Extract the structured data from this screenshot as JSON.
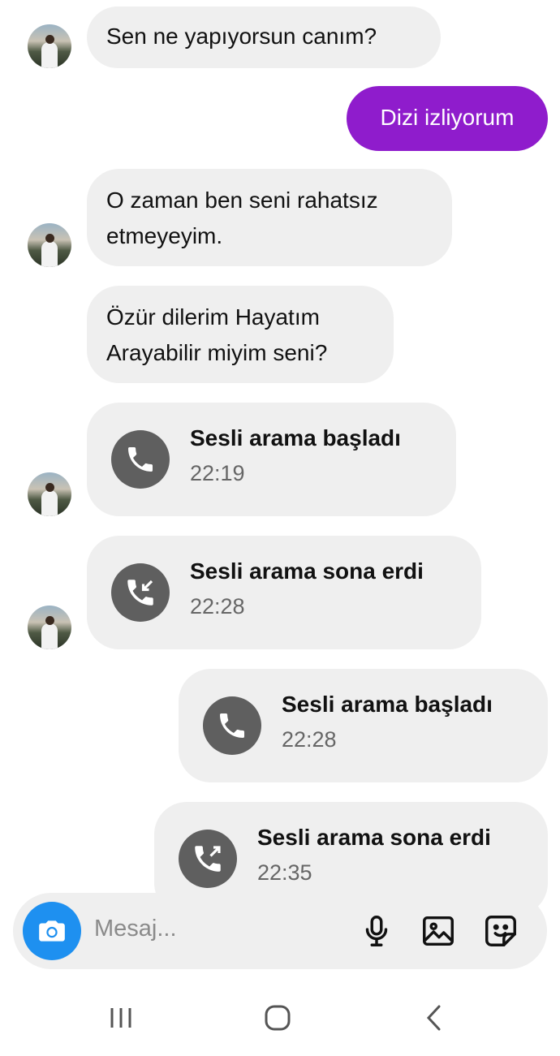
{
  "messages": [
    {
      "kind": "text",
      "side": "received",
      "text": "Sen ne yapıyorsun canım?"
    },
    {
      "kind": "text",
      "side": "sent",
      "text": "Dizi izliyorum"
    },
    {
      "kind": "text",
      "side": "received",
      "text": "O zaman ben seni rahatsız etmeyeyim."
    },
    {
      "kind": "text",
      "side": "received",
      "text": "Özür dilerim Hayatım Arayabilir miyim seni?"
    },
    {
      "kind": "call",
      "side": "received",
      "icon": "phone-icon",
      "title": "Sesli arama başladı",
      "time": "22:19"
    },
    {
      "kind": "call",
      "side": "received",
      "icon": "incoming-call-icon",
      "title": "Sesli arama sona erdi",
      "time": "22:28"
    },
    {
      "kind": "call",
      "side": "sent",
      "icon": "phone-icon",
      "title": "Sesli arama başladı",
      "time": "22:28"
    },
    {
      "kind": "call",
      "side": "sent",
      "icon": "outgoing-call-icon",
      "title": "Sesli arama sona erdi",
      "time": "22:35"
    }
  ],
  "composer": {
    "placeholder": "Mesaj...",
    "icons": [
      "camera-icon",
      "microphone-icon",
      "gallery-icon",
      "sticker-icon"
    ]
  },
  "nav": {
    "icons": [
      "recent-apps-icon",
      "home-icon",
      "back-icon"
    ]
  },
  "colors": {
    "sent_bubble": "#8f1ccc",
    "received_bubble": "#efefef",
    "camera_button": "#1e90f0",
    "call_icon_bg": "#5f5f5f"
  }
}
